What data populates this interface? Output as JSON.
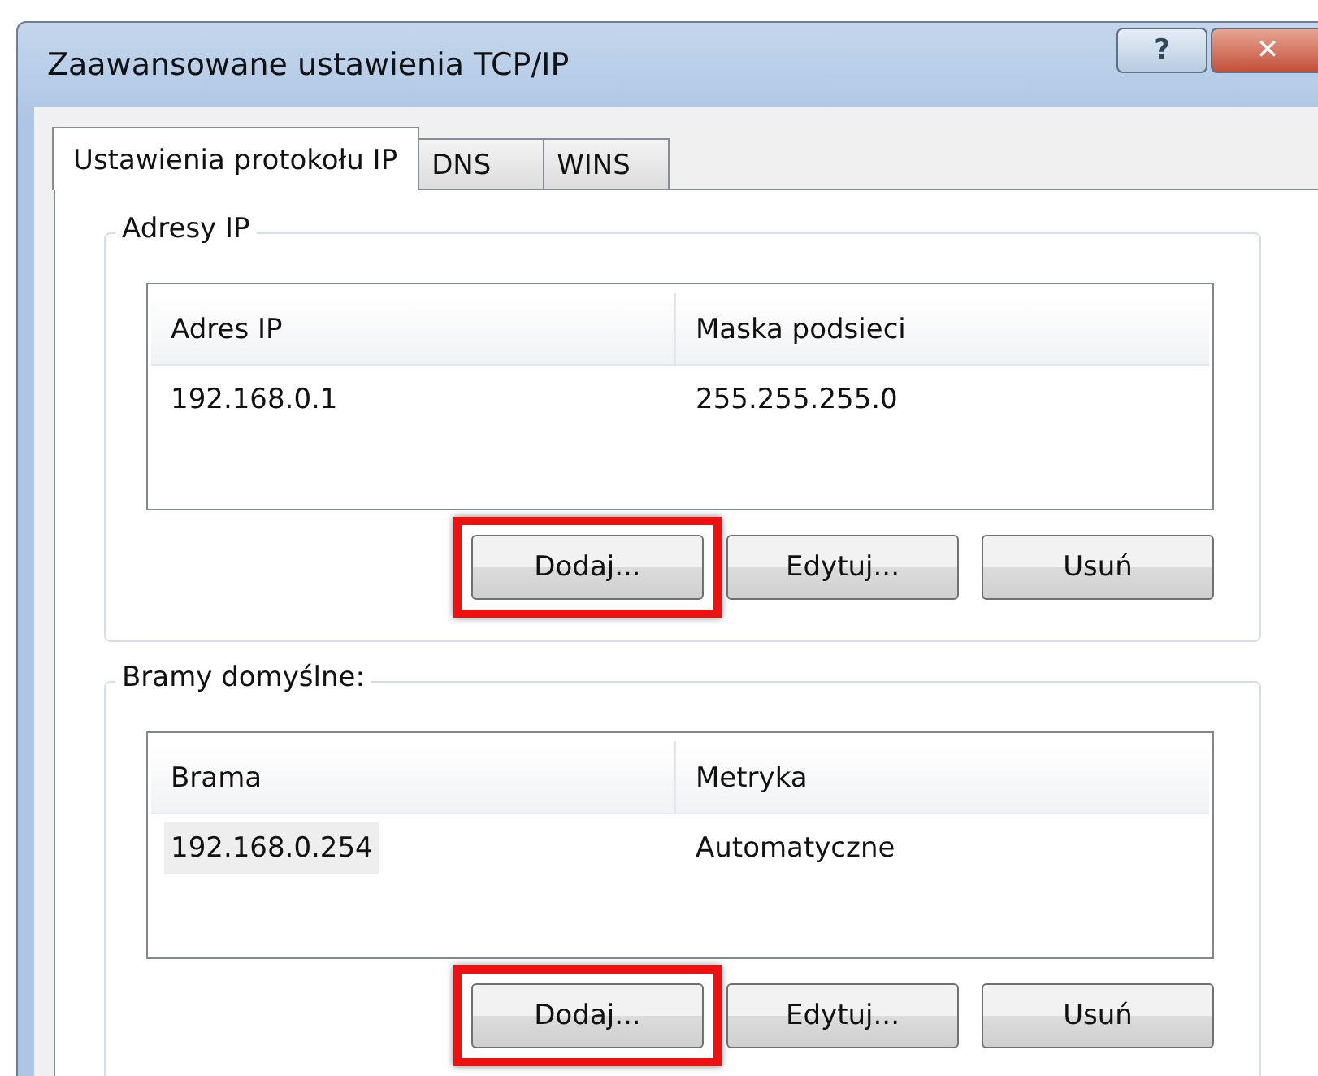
{
  "window": {
    "title": "Zaawansowane ustawienia TCP/IP",
    "title_buttons": [
      {
        "kind": "help",
        "label": "?"
      },
      {
        "kind": "close",
        "label": "✕"
      }
    ]
  },
  "tabs": [
    {
      "label": "Ustawienia protokołu IP",
      "selected": true
    },
    {
      "label": "DNS",
      "selected": false
    },
    {
      "label": "WINS",
      "selected": false
    }
  ],
  "groups": [
    {
      "title": "Adresy IP",
      "columns": [
        "Adres IP",
        "Maska podsieci"
      ],
      "rows": [
        {
          "cells": [
            "192.168.0.1",
            "255.255.255.0"
          ],
          "selected": false
        }
      ],
      "buttons": [
        {
          "label": "Dodaj...",
          "highlighted": true
        },
        {
          "label": "Edytuj...",
          "highlighted": false
        },
        {
          "label": "Usuń",
          "highlighted": false
        }
      ]
    },
    {
      "title": "Bramy domyślne:",
      "columns": [
        "Brama",
        "Metryka"
      ],
      "rows": [
        {
          "cells": [
            "192.168.0.254",
            "Automatyczne"
          ],
          "selected": true
        }
      ],
      "buttons": [
        {
          "label": "Dodaj...",
          "highlighted": true
        },
        {
          "label": "Edytuj...",
          "highlighted": false
        },
        {
          "label": "Usuń",
          "highlighted": false
        }
      ]
    }
  ]
}
